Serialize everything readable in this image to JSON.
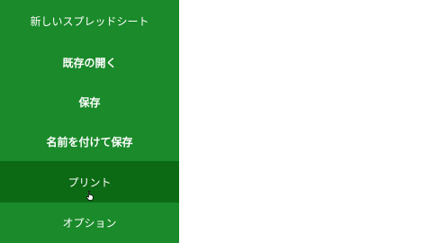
{
  "sidebar": {
    "items": [
      {
        "label": "新しいスプレッドシート"
      },
      {
        "label": "既存の開く"
      },
      {
        "label": "保存"
      },
      {
        "label": "名前を付けて保存"
      },
      {
        "label": "プリント"
      },
      {
        "label": "オプション"
      }
    ],
    "active_index": 4
  },
  "colors": {
    "sidebar_bg": "#1a8a2a",
    "active_bg": "#0c6a14",
    "text": "#ffffff",
    "content_bg": "#ffffff"
  }
}
